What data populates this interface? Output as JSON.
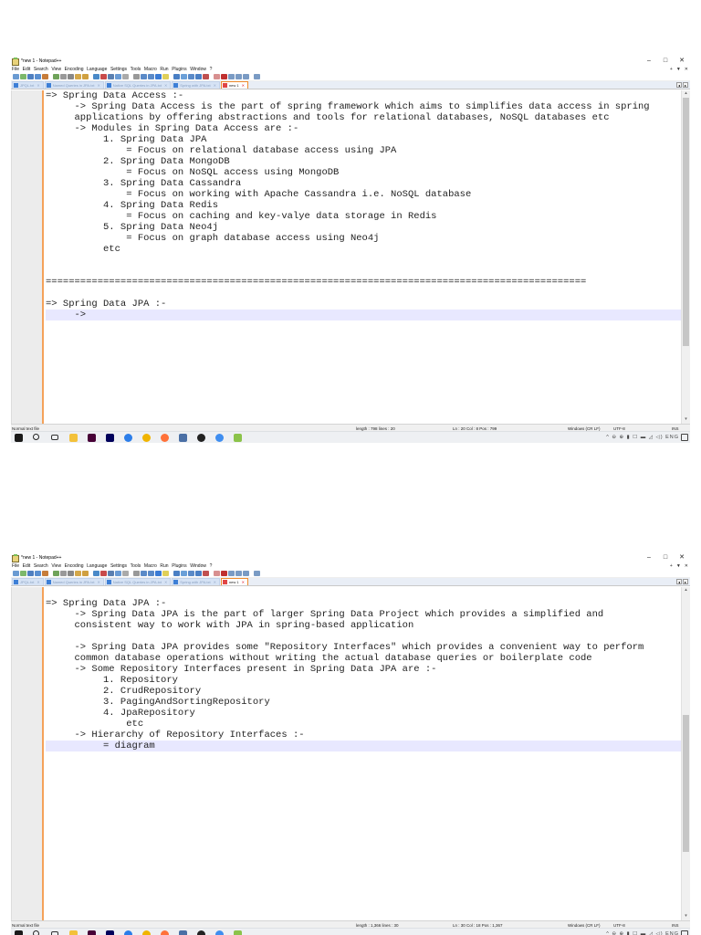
{
  "titlebar": {
    "title": "*new 1 - Notepad++",
    "controls": {
      "minimize": "–",
      "maximize": "□",
      "close": "✕"
    }
  },
  "menu": {
    "items": [
      "File",
      "Edit",
      "Search",
      "View",
      "Encoding",
      "Language",
      "Settings",
      "Tools",
      "Macro",
      "Run",
      "Plugins",
      "Window",
      "?"
    ],
    "right": [
      "+",
      "▼",
      "✕"
    ]
  },
  "tabs": [
    {
      "label": "JPQL.txt",
      "close": "✕"
    },
    {
      "label": "Named Queries in JPA.txt",
      "close": "✕"
    },
    {
      "label": "Native SQL Queries in JPA.txt",
      "close": "✕"
    },
    {
      "label": "Spring with JPA.txt",
      "close": "✕"
    },
    {
      "label": "new 1",
      "close": "✕"
    }
  ],
  "tab_scroll": [
    "◂",
    "▸"
  ],
  "screens": [
    {
      "lines": [
        {
          "n": "1",
          "t": "=> Spring Data Access :-"
        },
        {
          "n": "2",
          "t": "     -> Spring Data Access is the part of spring framework which aims to simplifies data access in spring"
        },
        {
          "n": "",
          "t": "     applications by offering abstractions and tools for relational databases, NoSQL databases etc"
        },
        {
          "n": "3",
          "t": "     -> Modules in Spring Data Access are :-"
        },
        {
          "n": "4",
          "t": "          1. Spring Data JPA"
        },
        {
          "n": "5",
          "t": "              = Focus on relational database access using JPA"
        },
        {
          "n": "6",
          "t": "          2. Spring Data MongoDB"
        },
        {
          "n": "7",
          "t": "              = Focus on NoSQL access using MongoDB"
        },
        {
          "n": "8",
          "t": "          3. Spring Data Cassandra"
        },
        {
          "n": "9",
          "t": "              = Focus on working with Apache Cassandra i.e. NoSQL database"
        },
        {
          "n": "10",
          "t": "          4. Spring Data Redis"
        },
        {
          "n": "11",
          "t": "              = Focus on caching and key-valye data storage in Redis"
        },
        {
          "n": "12",
          "t": "          5. Spring Data Neo4j"
        },
        {
          "n": "13",
          "t": "              = Focus on graph database access using Neo4j"
        },
        {
          "n": "14",
          "t": "          etc"
        },
        {
          "n": "15",
          "t": ""
        },
        {
          "n": "16",
          "t": ""
        },
        {
          "n": "17",
          "t": "=============================================================================================="
        },
        {
          "n": "18",
          "t": ""
        },
        {
          "n": "19",
          "t": "=> Spring Data JPA :-"
        },
        {
          "n": "20",
          "t": "     ->"
        }
      ],
      "status": {
        "type": "Normal text file",
        "length": "length : 798   lines : 20",
        "pos": "Ln : 20   Col : 8   Pos : 799",
        "eol": "Windows (CR LF)",
        "enc": "UTF-8",
        "mode": "INS"
      }
    },
    {
      "lines": [
        {
          "n": "18",
          "t": ""
        },
        {
          "n": "19",
          "t": "=> Spring Data JPA :-"
        },
        {
          "n": "20",
          "t": "     -> Spring Data JPA is the part of larger Spring Data Project which provides a simplified and"
        },
        {
          "n": "",
          "t": "     consistent way to work with JPA in spring-based application"
        },
        {
          "n": "21",
          "t": ""
        },
        {
          "n": "22",
          "t": "     -> Spring Data JPA provides some \"Repository Interfaces\" which provides a convenient way to perform"
        },
        {
          "n": "",
          "t": "     common database operations without writing the actual database queries or boilerplate code"
        },
        {
          "n": "23",
          "t": "     -> Some Repository Interfaces present in Spring Data JPA are :-"
        },
        {
          "n": "24",
          "t": "          1. Repository"
        },
        {
          "n": "25",
          "t": "          2. CrudRepository"
        },
        {
          "n": "26",
          "t": "          3. PagingAndSortingRepository"
        },
        {
          "n": "27",
          "t": "          4. JpaRepository"
        },
        {
          "n": "28",
          "t": "              etc"
        },
        {
          "n": "29",
          "t": "     -> Hierarchy of Repository Interfaces :-"
        },
        {
          "n": "30",
          "t": "          = diagram"
        }
      ],
      "status": {
        "type": "Normal text file",
        "length": "length : 1,366   lines : 30",
        "pos": "Ln : 30   Col : 18   Pos : 1,367",
        "eol": "Windows (CR LF)",
        "enc": "UTF-8",
        "mode": "INS"
      }
    }
  ],
  "taskbar": {
    "icons": [
      "windows-start",
      "search",
      "task-view",
      "file-explorer",
      "adobe-xd",
      "adobe-premiere",
      "chrome",
      "chrome-canary",
      "firefox",
      "vpn-shield",
      "media",
      "notepad-plus",
      "pen-tool"
    ],
    "tray": "^ ⊖ ⊕ ▮ ☐ ▬ ◿ ◁) ENG"
  },
  "colors": {
    "accent_orange": "#f4a25a",
    "current_line": "#e8e8ff",
    "gutter_bg": "#ececec"
  }
}
